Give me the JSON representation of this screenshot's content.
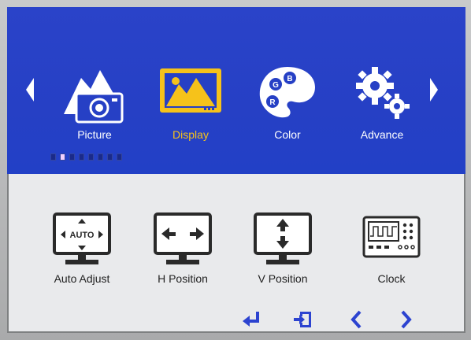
{
  "main_menu": {
    "items": [
      {
        "label": "Picture",
        "icon": "picture-icon",
        "active": false
      },
      {
        "label": "Display",
        "icon": "display-icon",
        "active": true
      },
      {
        "label": "Color",
        "icon": "color-palette-icon",
        "active": false
      },
      {
        "label": "Advance",
        "icon": "gears-icon",
        "active": false
      }
    ],
    "page_indicator": {
      "total": 8,
      "current": 2
    }
  },
  "submenu": {
    "items": [
      {
        "label": "Auto Adjust",
        "icon": "auto-adjust-icon",
        "icon_text": "AUTO"
      },
      {
        "label": "H Position",
        "icon": "h-position-icon"
      },
      {
        "label": "V Position",
        "icon": "v-position-icon"
      },
      {
        "label": "Clock",
        "icon": "clock-icon"
      }
    ]
  },
  "bottom_bar": {
    "items": [
      "enter-icon",
      "exit-icon",
      "left-chevron-icon",
      "right-chevron-icon"
    ]
  },
  "colors": {
    "menu_background": "#2640c5",
    "active_label": "#f6c21a",
    "icon_blue": "#2c43d0",
    "icon_white": "#ffffff",
    "icon_dark": "#2a2a2a"
  }
}
